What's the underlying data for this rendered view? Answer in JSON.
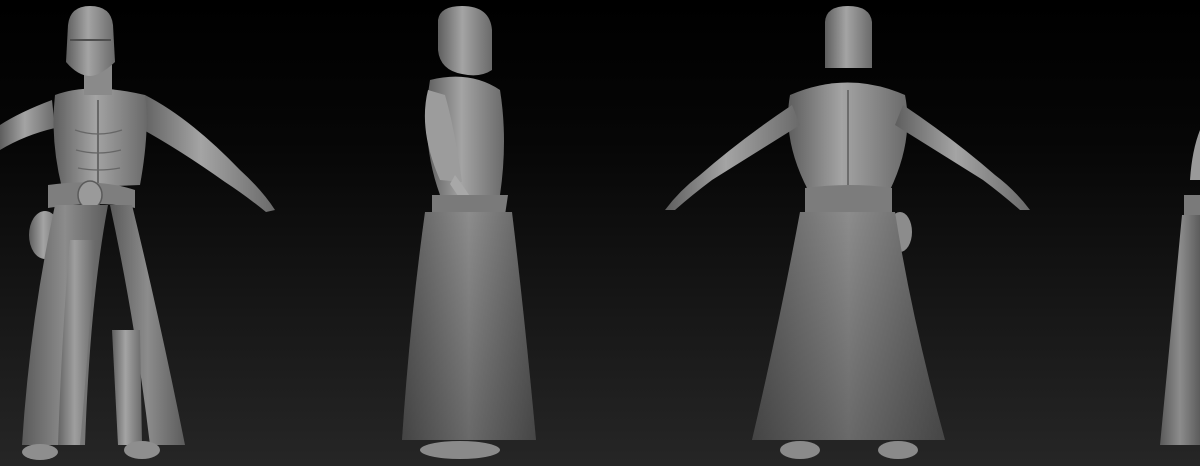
{
  "scene": {
    "subject": "sculpted-character-turnaround",
    "background_top": "#000000",
    "background_bottom": "#262626",
    "material_color": "#8a8a8a",
    "views": [
      {
        "view": "front"
      },
      {
        "view": "side"
      },
      {
        "view": "back"
      },
      {
        "view": "partial-side"
      }
    ]
  }
}
